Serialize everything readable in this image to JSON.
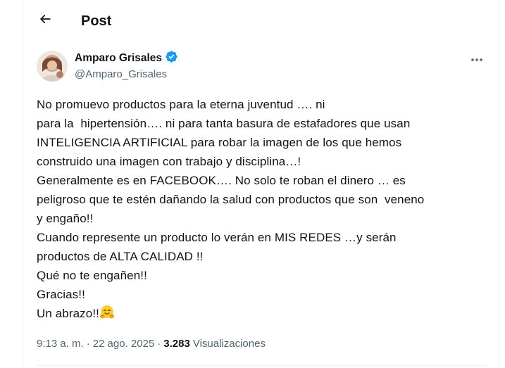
{
  "header": {
    "title": "Post"
  },
  "author": {
    "display_name": "Amparo Grisales",
    "handle": "@Amparo_Grisales",
    "verified": true
  },
  "post": {
    "lines": [
      "No promuevo productos para la eterna juventud …. ni",
      "para la  hipertensión…. ni para tanta basura de estafadores que usan",
      "INTELIGENCIA ARTIFICIAL para robar la imagen de los que hemos",
      "construido una imagen con trabajo y disciplina…!",
      "Generalmente es en FACEBOOK…. No solo te roban el dinero … es",
      "peligroso que te estén dañando la salud con productos que son  veneno",
      "y engaño!!",
      "Cuando represente un producto lo verán en MIS REDES …y serán",
      "productos de ALTA CALIDAD !!",
      "Qué no te engañen!!",
      "Gracias!!",
      "Un abrazo!!"
    ],
    "final_emoji": "hugging-face-emoji"
  },
  "meta": {
    "time": "9:13 a. m.",
    "separator": "·",
    "date": "22 ago. 2025",
    "views_count": "3.283",
    "views_label": "Visualizaciones"
  },
  "colors": {
    "verified": "#1d9bf0",
    "secondary_text": "#536471",
    "primary_text": "#0f1419"
  }
}
